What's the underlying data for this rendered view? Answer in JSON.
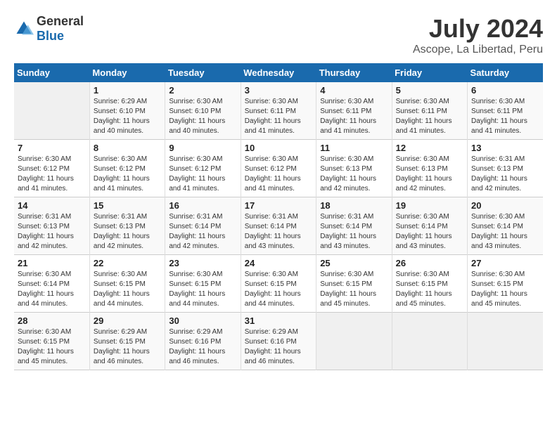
{
  "logo": {
    "general": "General",
    "blue": "Blue"
  },
  "title": "July 2024",
  "subtitle": "Ascope, La Libertad, Peru",
  "weekdays": [
    "Sunday",
    "Monday",
    "Tuesday",
    "Wednesday",
    "Thursday",
    "Friday",
    "Saturday"
  ],
  "weeks": [
    [
      {
        "day": "",
        "empty": true
      },
      {
        "day": "1",
        "sunrise": "6:29 AM",
        "sunset": "6:10 PM",
        "daylight": "11 hours and 40 minutes."
      },
      {
        "day": "2",
        "sunrise": "6:30 AM",
        "sunset": "6:10 PM",
        "daylight": "11 hours and 40 minutes."
      },
      {
        "day": "3",
        "sunrise": "6:30 AM",
        "sunset": "6:11 PM",
        "daylight": "11 hours and 41 minutes."
      },
      {
        "day": "4",
        "sunrise": "6:30 AM",
        "sunset": "6:11 PM",
        "daylight": "11 hours and 41 minutes."
      },
      {
        "day": "5",
        "sunrise": "6:30 AM",
        "sunset": "6:11 PM",
        "daylight": "11 hours and 41 minutes."
      },
      {
        "day": "6",
        "sunrise": "6:30 AM",
        "sunset": "6:11 PM",
        "daylight": "11 hours and 41 minutes."
      }
    ],
    [
      {
        "day": "7",
        "sunrise": "6:30 AM",
        "sunset": "6:12 PM",
        "daylight": "11 hours and 41 minutes."
      },
      {
        "day": "8",
        "sunrise": "6:30 AM",
        "sunset": "6:12 PM",
        "daylight": "11 hours and 41 minutes."
      },
      {
        "day": "9",
        "sunrise": "6:30 AM",
        "sunset": "6:12 PM",
        "daylight": "11 hours and 41 minutes."
      },
      {
        "day": "10",
        "sunrise": "6:30 AM",
        "sunset": "6:12 PM",
        "daylight": "11 hours and 41 minutes."
      },
      {
        "day": "11",
        "sunrise": "6:30 AM",
        "sunset": "6:13 PM",
        "daylight": "11 hours and 42 minutes."
      },
      {
        "day": "12",
        "sunrise": "6:30 AM",
        "sunset": "6:13 PM",
        "daylight": "11 hours and 42 minutes."
      },
      {
        "day": "13",
        "sunrise": "6:31 AM",
        "sunset": "6:13 PM",
        "daylight": "11 hours and 42 minutes."
      }
    ],
    [
      {
        "day": "14",
        "sunrise": "6:31 AM",
        "sunset": "6:13 PM",
        "daylight": "11 hours and 42 minutes."
      },
      {
        "day": "15",
        "sunrise": "6:31 AM",
        "sunset": "6:13 PM",
        "daylight": "11 hours and 42 minutes."
      },
      {
        "day": "16",
        "sunrise": "6:31 AM",
        "sunset": "6:14 PM",
        "daylight": "11 hours and 42 minutes."
      },
      {
        "day": "17",
        "sunrise": "6:31 AM",
        "sunset": "6:14 PM",
        "daylight": "11 hours and 43 minutes."
      },
      {
        "day": "18",
        "sunrise": "6:31 AM",
        "sunset": "6:14 PM",
        "daylight": "11 hours and 43 minutes."
      },
      {
        "day": "19",
        "sunrise": "6:30 AM",
        "sunset": "6:14 PM",
        "daylight": "11 hours and 43 minutes."
      },
      {
        "day": "20",
        "sunrise": "6:30 AM",
        "sunset": "6:14 PM",
        "daylight": "11 hours and 43 minutes."
      }
    ],
    [
      {
        "day": "21",
        "sunrise": "6:30 AM",
        "sunset": "6:14 PM",
        "daylight": "11 hours and 44 minutes."
      },
      {
        "day": "22",
        "sunrise": "6:30 AM",
        "sunset": "6:15 PM",
        "daylight": "11 hours and 44 minutes."
      },
      {
        "day": "23",
        "sunrise": "6:30 AM",
        "sunset": "6:15 PM",
        "daylight": "11 hours and 44 minutes."
      },
      {
        "day": "24",
        "sunrise": "6:30 AM",
        "sunset": "6:15 PM",
        "daylight": "11 hours and 44 minutes."
      },
      {
        "day": "25",
        "sunrise": "6:30 AM",
        "sunset": "6:15 PM",
        "daylight": "11 hours and 45 minutes."
      },
      {
        "day": "26",
        "sunrise": "6:30 AM",
        "sunset": "6:15 PM",
        "daylight": "11 hours and 45 minutes."
      },
      {
        "day": "27",
        "sunrise": "6:30 AM",
        "sunset": "6:15 PM",
        "daylight": "11 hours and 45 minutes."
      }
    ],
    [
      {
        "day": "28",
        "sunrise": "6:30 AM",
        "sunset": "6:15 PM",
        "daylight": "11 hours and 45 minutes."
      },
      {
        "day": "29",
        "sunrise": "6:29 AM",
        "sunset": "6:15 PM",
        "daylight": "11 hours and 46 minutes."
      },
      {
        "day": "30",
        "sunrise": "6:29 AM",
        "sunset": "6:16 PM",
        "daylight": "11 hours and 46 minutes."
      },
      {
        "day": "31",
        "sunrise": "6:29 AM",
        "sunset": "6:16 PM",
        "daylight": "11 hours and 46 minutes."
      },
      {
        "day": "",
        "empty": true
      },
      {
        "day": "",
        "empty": true
      },
      {
        "day": "",
        "empty": true
      }
    ]
  ]
}
